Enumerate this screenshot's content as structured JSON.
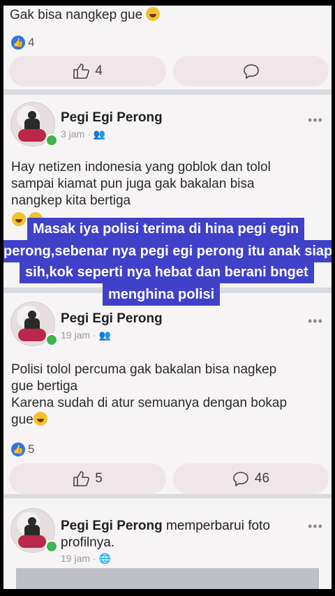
{
  "top_post": {
    "text": "Gak bisa nangkep gue",
    "reaction_count": "4",
    "like_count": "4"
  },
  "post1": {
    "author": "Pegi Egi Perong",
    "time": "3 jam",
    "audience_icon": "friends-icon",
    "text_lines": [
      "Hay netizen indonesia yang goblok dan tolol",
      "sampai kiamat pun juga gak bakalan bisa",
      "nangkep kita bertiga"
    ]
  },
  "caption": {
    "lines": [
      "Masak iya polisi terima di hina pegi egin",
      "perong,sebenar nya pegi egi perong itu anak siapa",
      "sih,kok seperti nya hebat dan berani bnget",
      "menghina polisi"
    ]
  },
  "post2": {
    "author": "Pegi Egi Perong",
    "time": "19 jam",
    "audience_icon": "friends-icon",
    "text_lines": [
      "Polisi tolol percuma gak bakalan bisa nagkep",
      "gue bertiga",
      "Karena sudah di atur semuanya dengan bokap",
      "gue"
    ],
    "reaction_count": "5",
    "like_count": "5",
    "comment_count": "46"
  },
  "post3": {
    "author": "Pegi Egi Perong",
    "action": "memperbarui foto",
    "action_line2": "profilnya.",
    "time": "19 jam",
    "audience_icon": "globe-icon"
  },
  "colors": {
    "like_blue": "#2d75e8",
    "caption_bg": "#3f41c8",
    "online_green": "#3db44e"
  }
}
